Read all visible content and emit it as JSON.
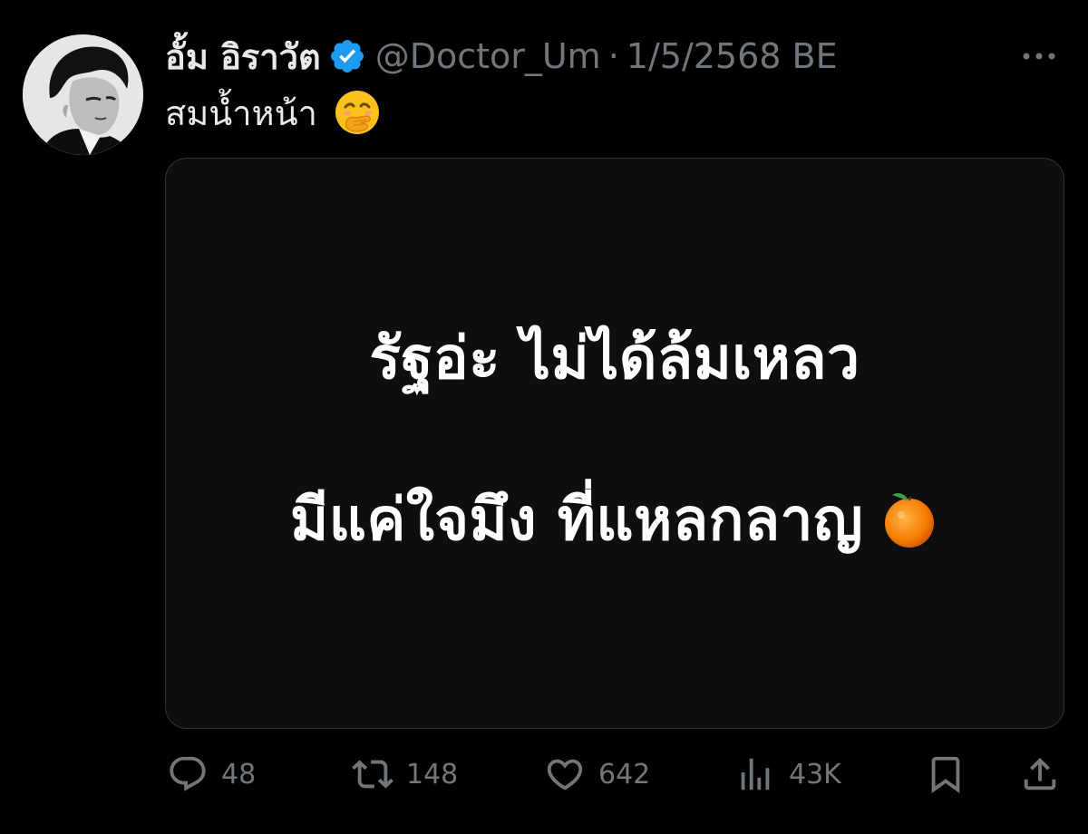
{
  "author": {
    "display_name": "อั้ม อิราวัต",
    "handle": "@Doctor_Um",
    "separator": "·",
    "date": "1/5/2568 BE",
    "verified": true,
    "verified_color": "#1d9bf0",
    "avatar_icon": "profile-photo-man-icon"
  },
  "tweet": {
    "text": "สมน้ำหน้า",
    "emoji_icon": "face-with-hand-over-mouth-icon"
  },
  "media": {
    "line1": "รัฐอ่ะ ไม่ได้ล้มเหลว",
    "line2": "มีแค่ใจมึง ที่แหลกลาญ",
    "emoji_icon": "tangerine-icon"
  },
  "actions": {
    "reply_count": "48",
    "retweet_count": "148",
    "like_count": "642",
    "views_count": "43K",
    "icons": [
      "reply-icon",
      "retweet-icon",
      "like-icon",
      "views-icon",
      "bookmark-icon",
      "share-icon"
    ]
  },
  "colors": {
    "background": "#000000",
    "text_primary": "#e7e9ea",
    "text_secondary": "#71767b",
    "border": "#2f3336"
  }
}
